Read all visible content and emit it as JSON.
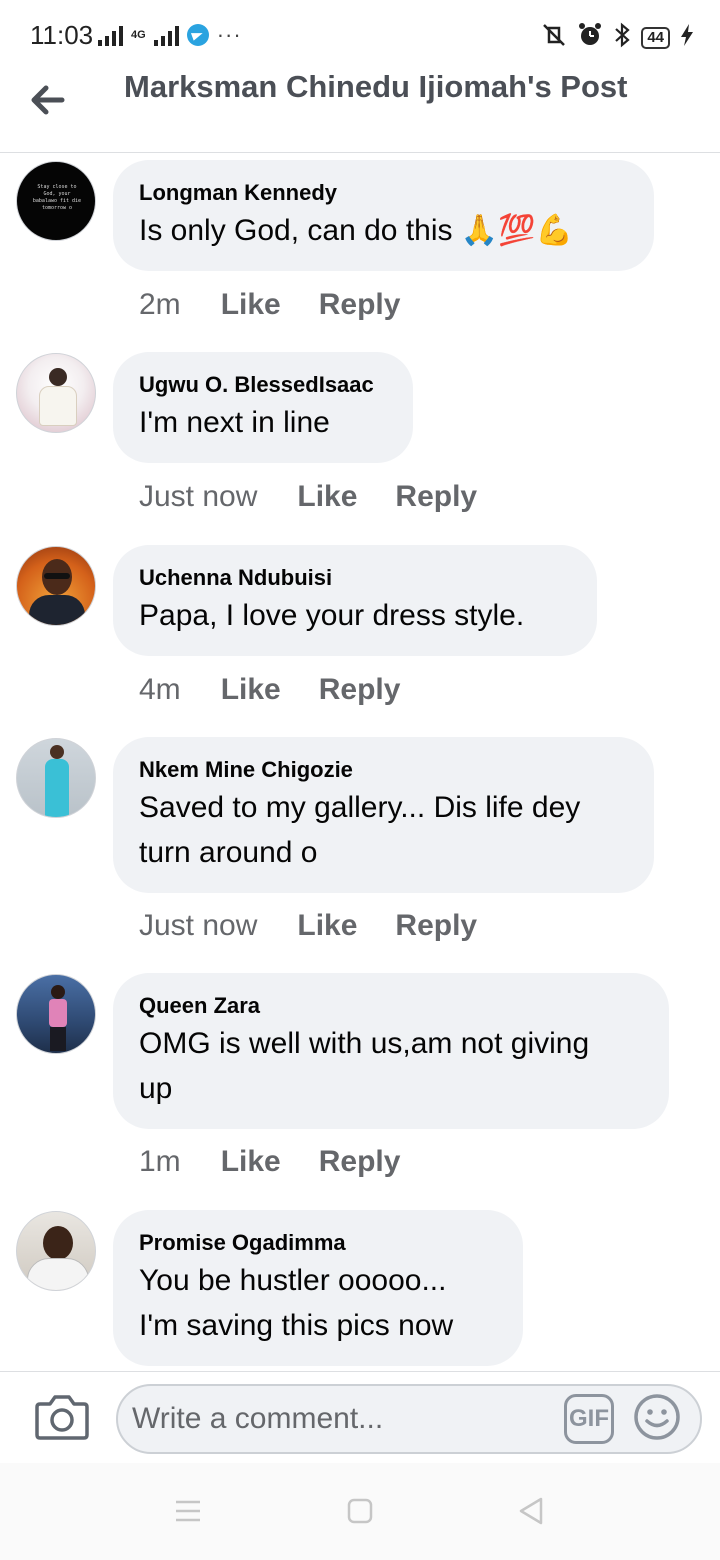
{
  "status": {
    "time": "11:03",
    "network": "4G",
    "battery": "44",
    "more": "···"
  },
  "header": {
    "title": "Marksman Chinedu Ijiomah's Post"
  },
  "comments": [
    {
      "author": "Longman Kennedy",
      "text": "Is only God, can do this ",
      "emoji": "🙏💯💪",
      "time": "2m",
      "like": "Like",
      "reply": "Reply"
    },
    {
      "author": "Ugwu O. BlessedIsaac",
      "text": "I'm next in line",
      "time": "Just now",
      "like": "Like",
      "reply": "Reply"
    },
    {
      "author": "Uchenna Ndubuisi",
      "text": "Papa, I love your dress style.",
      "time": "4m",
      "like": "Like",
      "reply": "Reply"
    },
    {
      "author": "Nkem Mine Chigozie",
      "text_line1": "Saved to my gallery... Dis life dey",
      "text_line2": "turn around o",
      "time": "Just now",
      "like": "Like",
      "reply": "Reply"
    },
    {
      "author": "Queen Zara",
      "text_line1": "OMG is well with us,am not giving",
      "text_line2": "up",
      "time": "1m",
      "like": "Like",
      "reply": "Reply"
    },
    {
      "author": "Promise Ogadimma",
      "text_line1": "You be hustler ooooo...",
      "text_line2": "I'm saving this pics now"
    }
  ],
  "composer": {
    "placeholder": "Write a comment...",
    "gif_label": "GIF"
  },
  "avatar1_text": "Stay close to God, your babalawo fit die tomorrow o"
}
